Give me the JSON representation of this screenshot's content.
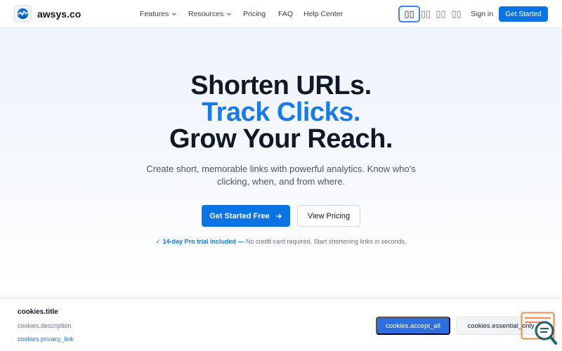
{
  "nav": {
    "brand": "awsys.co",
    "menu": [
      {
        "label": "Features",
        "has_dropdown": true
      },
      {
        "label": "Resources",
        "has_dropdown": true
      },
      {
        "label": "Pricing",
        "has_dropdown": false
      },
      {
        "label": "FAQ",
        "has_dropdown": false
      },
      {
        "label": "Help Center",
        "has_dropdown": false
      }
    ],
    "languages": [
      "▯▯",
      "▯▯",
      "▯▯",
      "▯▯"
    ],
    "sign_in": "Sign in",
    "get_started": "Get Started"
  },
  "hero": {
    "line1": "Shorten URLs.",
    "line2": "Track Clicks.",
    "line3": "Grow Your Reach.",
    "subtitle": "Create short, memorable links with powerful analytics. Know who's clicking, when, and from where.",
    "cta_primary": "Get Started Free",
    "cta_secondary": "View Pricing",
    "trial_check": "✓",
    "trial_highlight": "14-day Pro trial included —",
    "trial_rest": " No credit card required. Start shortening links in seconds."
  },
  "cookie": {
    "title": "cookies.title",
    "description": "cookies.description",
    "privacy_link": "cookies.privacy_link",
    "accept_all": "cookies.accept_all",
    "essential_only": "cookies.essential_only"
  },
  "colors": {
    "accent": "#0b74e5",
    "headline_blue": "#1a7ae6",
    "fab_orange": "#f08a4b",
    "fab_teal": "#1f5f6a"
  }
}
